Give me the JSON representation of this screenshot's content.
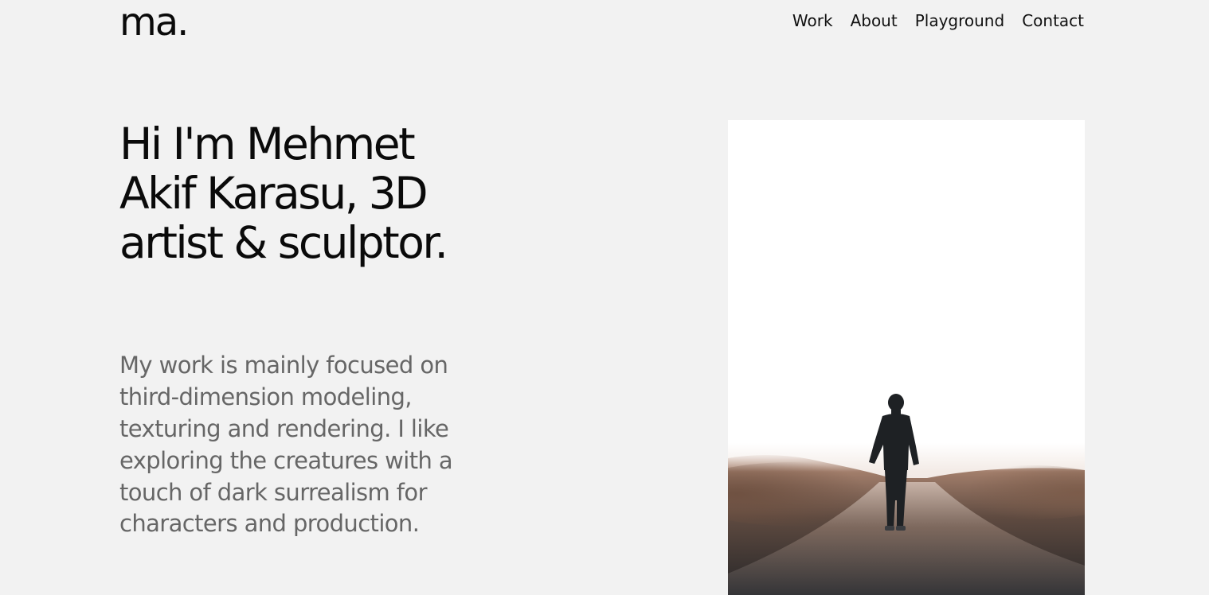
{
  "header": {
    "logo": "ma.",
    "nav": [
      {
        "label": "Work"
      },
      {
        "label": "About"
      },
      {
        "label": "Playground"
      },
      {
        "label": "Contact"
      }
    ]
  },
  "hero": {
    "headline": "Hi I'm Mehmet Akif Karasu, 3D artist & sculptor.",
    "bio": "My work is mainly focused on third-dimension modeling, texturing and rendering. I like exploring the creatures with a touch of dark surrealism for characters and production.",
    "image": {
      "alt": "person walking on road in fog"
    }
  },
  "colors": {
    "background": "#f2f2f2",
    "text": "#0a0a0a",
    "muted_text": "#666666"
  }
}
